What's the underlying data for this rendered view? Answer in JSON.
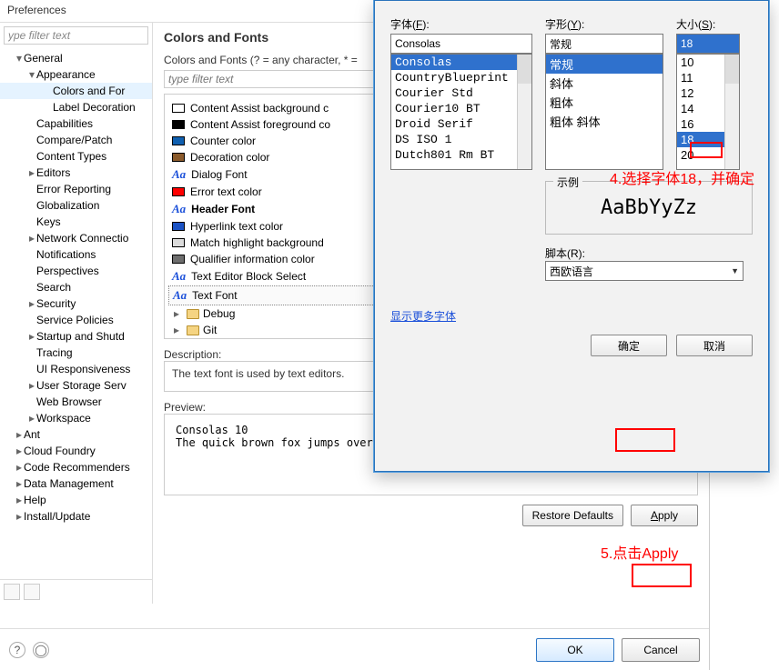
{
  "prefs": {
    "title": "Preferences",
    "filter_placeholder": "ype filter text",
    "tree": [
      {
        "exp": "▾",
        "label": "General",
        "lvl": 1
      },
      {
        "exp": "▾",
        "label": "Appearance",
        "lvl": 2
      },
      {
        "exp": "",
        "label": "Colors and For",
        "lvl": 3,
        "sel": true
      },
      {
        "exp": "",
        "label": "Label Decoration",
        "lvl": 3
      },
      {
        "exp": "",
        "label": "Capabilities",
        "lvl": 2
      },
      {
        "exp": "",
        "label": "Compare/Patch",
        "lvl": 2
      },
      {
        "exp": "",
        "label": "Content Types",
        "lvl": 2
      },
      {
        "exp": "▸",
        "label": "Editors",
        "lvl": 2
      },
      {
        "exp": "",
        "label": "Error Reporting",
        "lvl": 2
      },
      {
        "exp": "",
        "label": "Globalization",
        "lvl": 2
      },
      {
        "exp": "",
        "label": "Keys",
        "lvl": 2
      },
      {
        "exp": "▸",
        "label": "Network Connectio",
        "lvl": 2
      },
      {
        "exp": "",
        "label": "Notifications",
        "lvl": 2
      },
      {
        "exp": "",
        "label": "Perspectives",
        "lvl": 2
      },
      {
        "exp": "",
        "label": "Search",
        "lvl": 2
      },
      {
        "exp": "▸",
        "label": "Security",
        "lvl": 2
      },
      {
        "exp": "",
        "label": "Service Policies",
        "lvl": 2
      },
      {
        "exp": "▸",
        "label": "Startup and Shutd",
        "lvl": 2
      },
      {
        "exp": "",
        "label": "Tracing",
        "lvl": 2
      },
      {
        "exp": "",
        "label": "UI Responsiveness",
        "lvl": 2
      },
      {
        "exp": "▸",
        "label": "User Storage Serv",
        "lvl": 2
      },
      {
        "exp": "",
        "label": "Web Browser",
        "lvl": 2
      },
      {
        "exp": "▸",
        "label": "Workspace",
        "lvl": 2
      },
      {
        "exp": "▸",
        "label": "Ant",
        "lvl": 1
      },
      {
        "exp": "▸",
        "label": "Cloud Foundry",
        "lvl": 1
      },
      {
        "exp": "▸",
        "label": "Code Recommenders",
        "lvl": 1
      },
      {
        "exp": "▸",
        "label": "Data Management",
        "lvl": 1
      },
      {
        "exp": "▸",
        "label": "Help",
        "lvl": 1
      },
      {
        "exp": "▸",
        "label": "Install/Update",
        "lvl": 1
      }
    ],
    "right_title": "Colors and Fonts",
    "hint": "Colors and Fonts (? = any character, * =",
    "filter2_placeholder": "type filter text",
    "items": [
      {
        "type": "sw",
        "color": "#ffffff",
        "label": "Content Assist background c"
      },
      {
        "type": "sw",
        "color": "#000000",
        "label": "Content Assist foreground co"
      },
      {
        "type": "sw",
        "color": "#1060b0",
        "label": "Counter color"
      },
      {
        "type": "sw",
        "color": "#8a5a2b",
        "label": "Decoration color"
      },
      {
        "type": "aa",
        "label": "Dialog Font"
      },
      {
        "type": "sw",
        "color": "#ff0000",
        "label": "Error text color"
      },
      {
        "type": "aa",
        "label": "Header Font",
        "bold": true
      },
      {
        "type": "sw",
        "color": "#1b52c4",
        "label": "Hyperlink text color"
      },
      {
        "type": "sw",
        "color": "#dcdcdc",
        "label": "Match highlight background"
      },
      {
        "type": "sw",
        "color": "#6e6e6e",
        "label": "Qualifier information color"
      },
      {
        "type": "aa",
        "label": "Text Editor Block Select"
      },
      {
        "type": "aa",
        "label": "Text Font",
        "sel": true
      }
    ],
    "folders": [
      {
        "label": "Debug"
      },
      {
        "label": "Git"
      }
    ],
    "desc_label": "Description:",
    "desc_text": "The text font is used by text editors.",
    "prev_label": "Preview:",
    "prev_text": "Consolas 10\nThe quick brown fox jumps over the lazy dog.",
    "restore": "Restore Defaults",
    "apply": "Apply",
    "ok": "OK",
    "cancel": "Cancel"
  },
  "font": {
    "col_font": "字体(F):",
    "col_style": "字形(Y):",
    "col_size": "大小(S):",
    "font_value": "Consolas",
    "style_value": "常规",
    "size_value": "18",
    "fonts": [
      "Consolas",
      "CountryBlueprint",
      "Courier Std",
      "Courier10 BT",
      "Droid Serif",
      "DS ISO 1",
      "Dutch801 Rm BT"
    ],
    "styles": [
      "常规",
      "斜体",
      "粗体",
      "粗体 斜体"
    ],
    "sizes": [
      "10",
      "11",
      "12",
      "14",
      "16",
      "18",
      "20"
    ],
    "sample_label": "示例",
    "sample_text": "AaBbYyZz",
    "script_label": "脚本(R):",
    "script_value": "西欧语言",
    "more": "显示更多字体",
    "ok": "确定",
    "cancel": "取消"
  },
  "annotations": {
    "a4": "4.选择字体18，并确定",
    "a5": "5.点击Apply"
  }
}
